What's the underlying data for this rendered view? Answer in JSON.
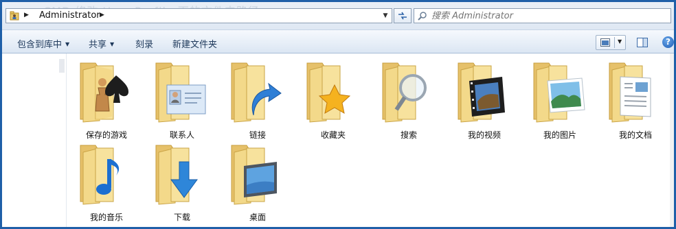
{
  "address": {
    "ghost_title": "CMD 修改 User Profile 下的文件夹路径",
    "breadcrumb": "Administrator",
    "location_icon": "user-folder-icon",
    "refresh_icon": "refresh-icon"
  },
  "search": {
    "placeholder": "搜索 Administrator",
    "icon": "search-icon"
  },
  "toolbar": {
    "include_label": "包含到库中",
    "share_label": "共享",
    "burn_label": "刻录",
    "new_folder_label": "新建文件夹",
    "view_icon": "view-options-icon",
    "preview_icon": "preview-pane-icon",
    "help_label": "?"
  },
  "colors": {
    "frame": "#1f5fa8",
    "toolbar_text": "#1e395b",
    "folder_body": "#f3d98a"
  },
  "folders": [
    {
      "label": "保存的游戏",
      "icon": "saved-games-folder-icon"
    },
    {
      "label": "联系人",
      "icon": "contacts-folder-icon"
    },
    {
      "label": "链接",
      "icon": "links-folder-icon"
    },
    {
      "label": "收藏夹",
      "icon": "favorites-folder-icon"
    },
    {
      "label": "搜索",
      "icon": "searches-folder-icon"
    },
    {
      "label": "我的视频",
      "icon": "videos-folder-icon"
    },
    {
      "label": "我的图片",
      "icon": "pictures-folder-icon"
    },
    {
      "label": "我的文档",
      "icon": "documents-folder-icon"
    },
    {
      "label": "我的音乐",
      "icon": "music-folder-icon"
    },
    {
      "label": "下载",
      "icon": "downloads-folder-icon"
    },
    {
      "label": "桌面",
      "icon": "desktop-folder-icon"
    }
  ]
}
